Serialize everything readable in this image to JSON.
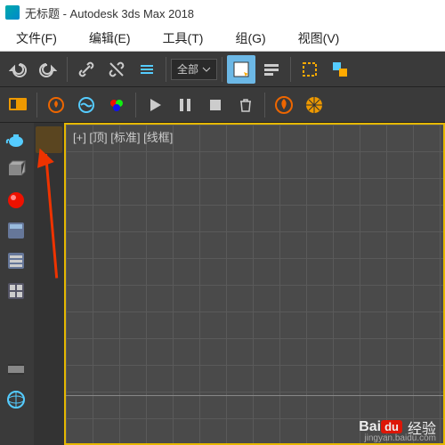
{
  "title": "无标题 - Autodesk 3ds Max 2018",
  "menu": {
    "file": "文件(F)",
    "edit": "编辑(E)",
    "tools": "工具(T)",
    "group": "组(G)",
    "view": "视图(V)"
  },
  "toolbar": {
    "dropdown_all": "全部",
    "icons": {
      "undo": "undo-icon",
      "redo": "redo-icon",
      "link": "link-icon",
      "unlink": "unlink-icon",
      "bind": "bind-icon",
      "select": "select-icon",
      "selectname": "select-name-icon",
      "rect": "marquee-icon",
      "window": "window-crossing-icon",
      "workspace": "workspace-icon",
      "fire": "fire-icon",
      "water": "water-icon",
      "color": "color-icon",
      "play": "play-icon",
      "pause": "pause-icon",
      "stop": "stop-icon",
      "trash": "trash-icon",
      "fireball": "fireball-icon",
      "render": "render-icon"
    }
  },
  "viewport": {
    "label": "[+] [顶] [标准] [线框]"
  },
  "sidebar": {
    "items": [
      "teapot-icon",
      "box-icon",
      "sphere-icon",
      "panel-icon",
      "track-icon",
      "list-icon",
      "film-icon",
      "globe-icon"
    ]
  },
  "watermark": {
    "brand_left": "Bai",
    "brand_right": "du",
    "text": "经验",
    "sub": "jingyan.baidu.com"
  }
}
